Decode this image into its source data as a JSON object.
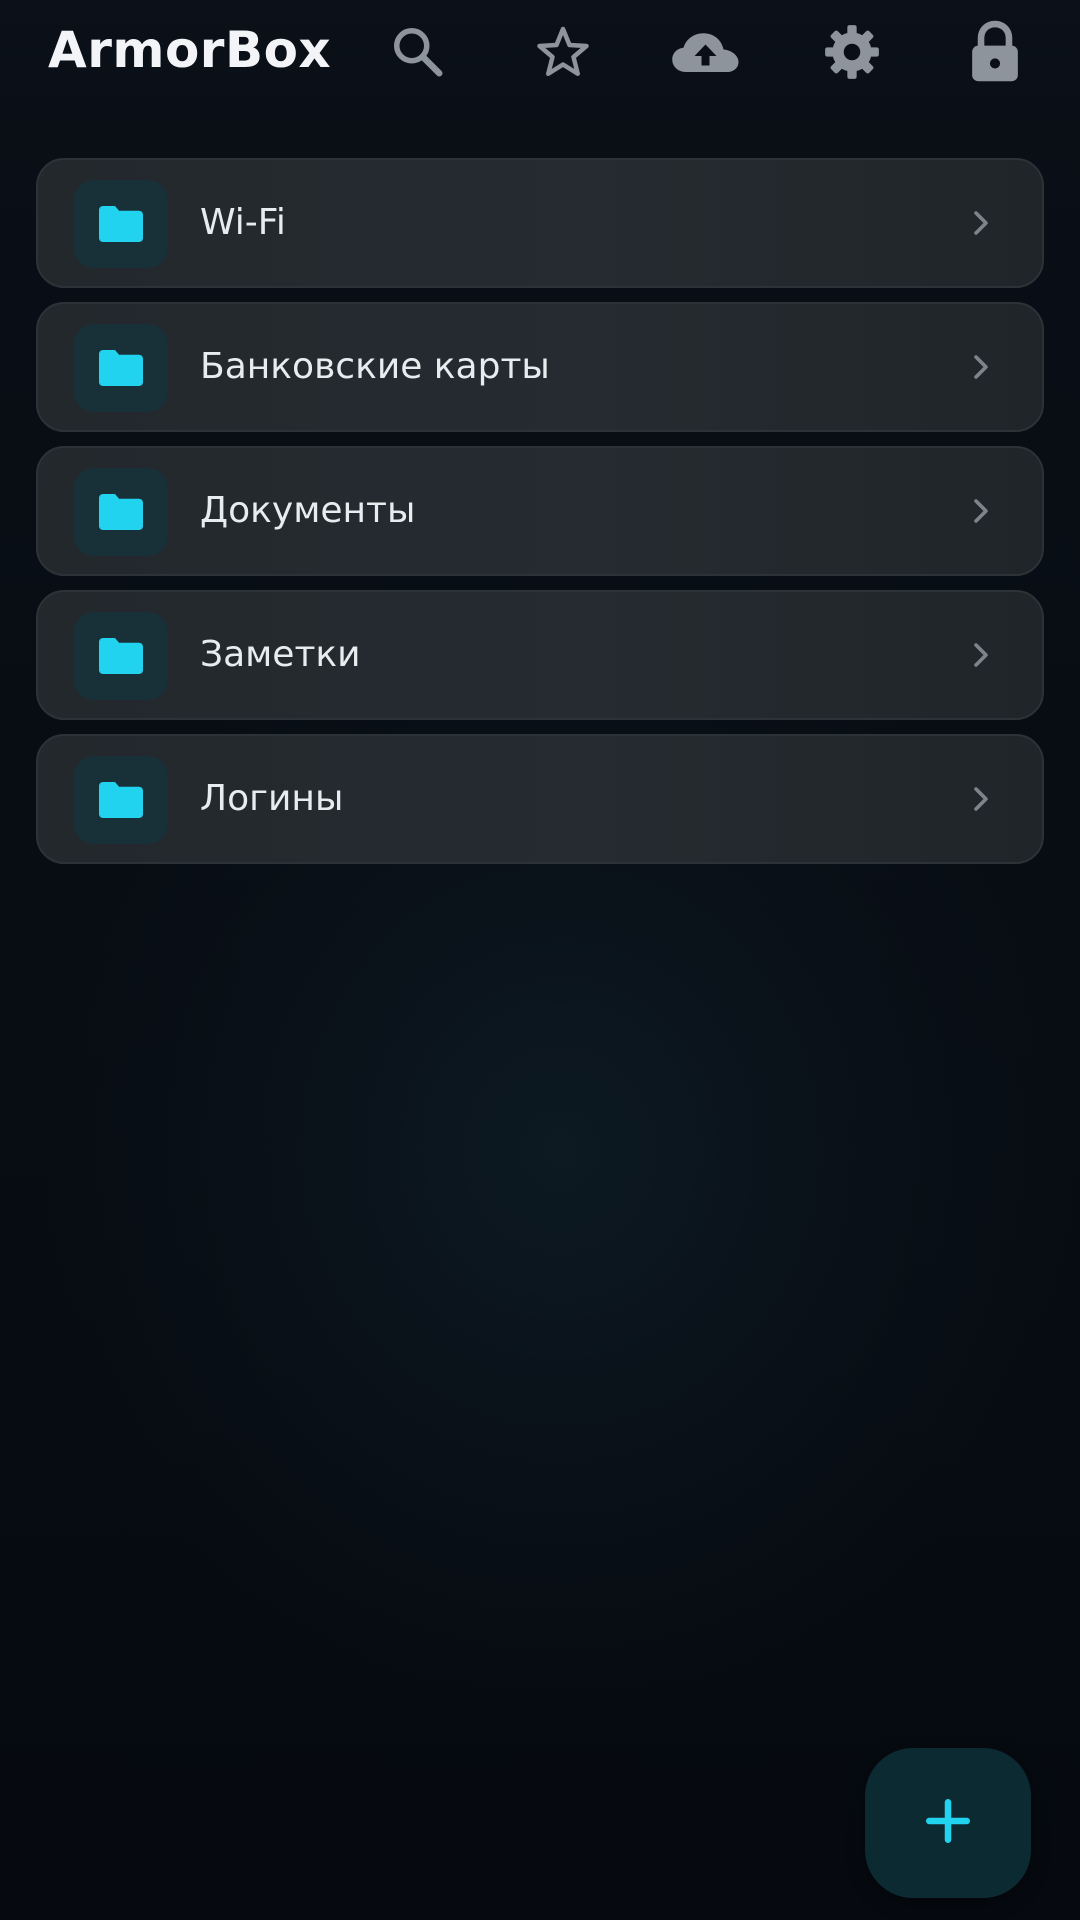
{
  "app": {
    "title": "ArmorBox"
  },
  "toolbar": {
    "icons": [
      "search-icon",
      "star-icon",
      "cloud-upload-icon",
      "settings-gear-icon",
      "lock-icon"
    ]
  },
  "folders": [
    {
      "label": "Wi-Fi",
      "icon": "folder-icon"
    },
    {
      "label": "Банковские карты",
      "icon": "folder-icon"
    },
    {
      "label": "Документы",
      "icon": "folder-icon"
    },
    {
      "label": "Заметки",
      "icon": "folder-icon"
    },
    {
      "label": "Логины",
      "icon": "folder-icon"
    }
  ],
  "fab": {
    "icon": "plus-icon"
  },
  "colors": {
    "background": "#070b12",
    "card": "#23282d",
    "accent": "#22d3f0",
    "icon_gray": "#8e949b",
    "text": "#e9ecef"
  }
}
